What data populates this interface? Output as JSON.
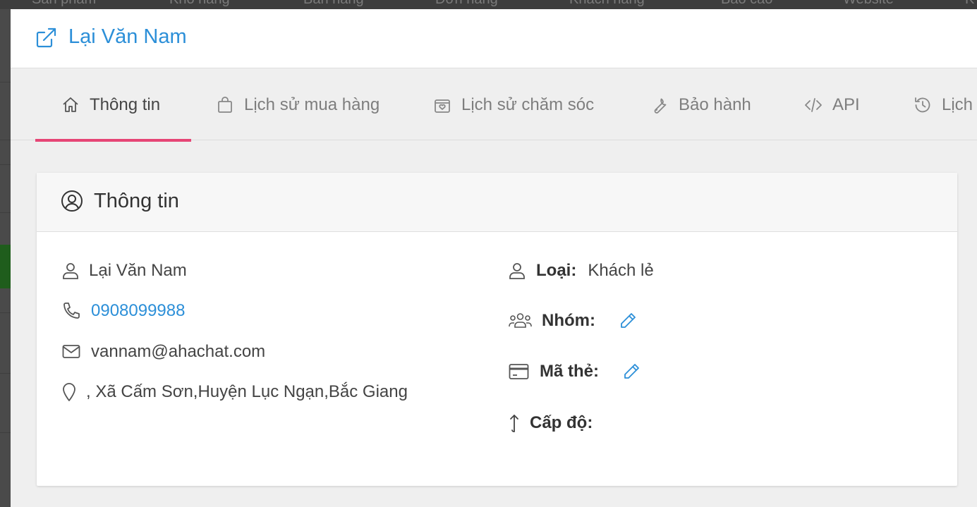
{
  "background_nav": [
    "Sản phẩm",
    "Kho hàng",
    "Bán hàng",
    "Đơn hàng",
    "Khách hàng",
    "Báo cáo",
    "Website",
    "K"
  ],
  "modal": {
    "title": "Lại Văn Nam"
  },
  "tabs": [
    {
      "label": "Thông tin",
      "icon": "home-icon",
      "active": true
    },
    {
      "label": "Lịch sử mua hàng",
      "icon": "shopping-bag-icon",
      "active": false
    },
    {
      "label": "Lịch sử chăm sóc",
      "icon": "gift-box-heart-icon",
      "active": false
    },
    {
      "label": "Bảo hành",
      "icon": "wrench-icon",
      "active": false
    },
    {
      "label": "API",
      "icon": "code-icon",
      "active": false
    },
    {
      "label": "Lịch",
      "icon": "history-icon",
      "active": false
    }
  ],
  "info_card": {
    "title": "Thông tin",
    "name": "Lại Văn Nam",
    "phone": "0908099988",
    "email": "vannam@ahachat.com",
    "address": ", Xã Cấm Sơn,Huyện Lục Ngạn,Bắc Giang",
    "type_label": "Loại:",
    "type_value": "Khách lẻ",
    "group_label": "Nhóm:",
    "card_label": "Mã thẻ:",
    "level_label": "Cấp độ:"
  },
  "colors": {
    "accent": "#2c8fd8",
    "tab_underline": "#e64575",
    "text": "#444444"
  }
}
